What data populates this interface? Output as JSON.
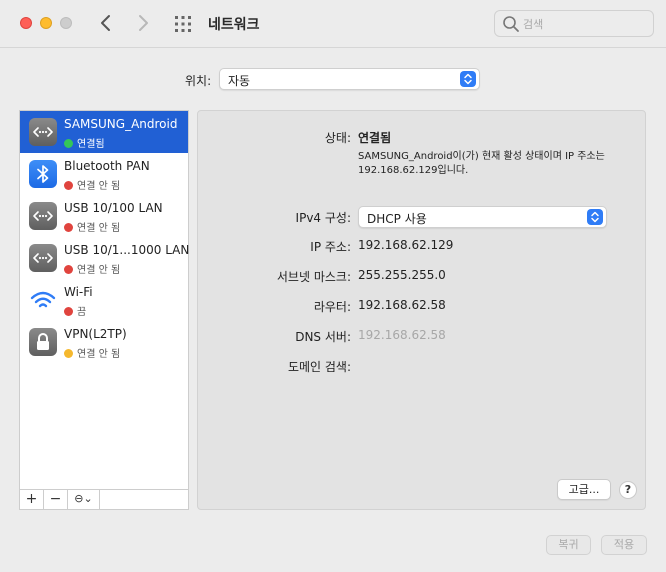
{
  "window": {
    "title": "네트워크",
    "search_placeholder": "검색"
  },
  "location": {
    "label": "위치:",
    "value": "자동"
  },
  "services": [
    {
      "name": "SAMSUNG_Android",
      "status": "연결됨",
      "status_color": "#34c759",
      "icon": "ethernet-arrows-icon",
      "selected": true
    },
    {
      "name": "Bluetooth PAN",
      "status": "연결 안 됨",
      "status_color": "#e0443e",
      "icon": "bluetooth-icon",
      "selected": false
    },
    {
      "name": "USB 10/100 LAN",
      "status": "연결 안 됨",
      "status_color": "#e0443e",
      "icon": "ethernet-arrows-icon",
      "selected": false
    },
    {
      "name": "USB 10/1...1000 LAN",
      "status": "연결 안 됨",
      "status_color": "#e0443e",
      "icon": "ethernet-arrows-icon",
      "selected": false
    },
    {
      "name": "Wi-Fi",
      "status": "끔",
      "status_color": "#e0443e",
      "icon": "wifi-icon",
      "selected": false
    },
    {
      "name": "VPN(L2TP)",
      "status": "연결 안 됨",
      "status_color": "#f5b82e",
      "icon": "lock-icon",
      "selected": false
    }
  ],
  "toolbar": {
    "add": "+",
    "remove": "−",
    "action": "⊖⌄"
  },
  "detail": {
    "status_label": "상태:",
    "status_value": "연결됨",
    "status_desc": "SAMSUNG_Android이(가) 현재 활성 상태이며 IP 주소는 192.168.62.129입니다.",
    "ipv4_label": "IPv4 구성:",
    "ipv4_value": "DHCP 사용",
    "ip_label": "IP 주소:",
    "ip_value": "192.168.62.129",
    "subnet_label": "서브넷 마스크:",
    "subnet_value": "255.255.255.0",
    "router_label": "라우터:",
    "router_value": "192.168.62.58",
    "dns_label": "DNS 서버:",
    "dns_value": "192.168.62.58",
    "domain_label": "도메인 검색:",
    "advanced_button": "고급...",
    "help_button": "?"
  },
  "footer": {
    "revert_button": "복귀",
    "apply_button": "적용"
  },
  "colors": {
    "selection": "#2160d4",
    "accent": "#2f7cf6"
  }
}
